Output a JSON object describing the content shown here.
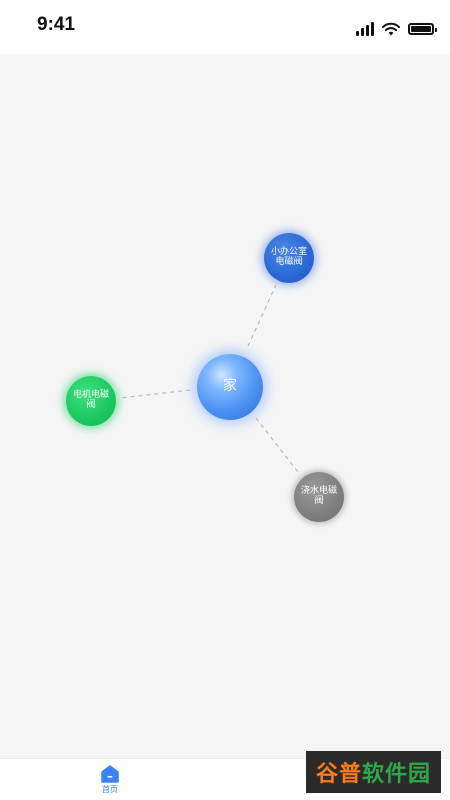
{
  "status_bar": {
    "time": "9:41",
    "icons": [
      "cellular-signal-icon",
      "wifi-icon",
      "battery-icon"
    ]
  },
  "graph": {
    "center": {
      "label": "家"
    },
    "nodes": [
      {
        "id": "office",
        "label": "小办公室电磁阀",
        "color": "#2b68d6"
      },
      {
        "id": "motor",
        "label": "电机电磁阀",
        "color": "#19c960"
      },
      {
        "id": "water",
        "label": "浇水电磁阀",
        "color": "#7e7e7e"
      }
    ],
    "link_color": "#b9b9b9"
  },
  "tab_bar": {
    "tabs": [
      {
        "label": "首页",
        "icon": "home-icon",
        "active": true,
        "color": "#3b82f6"
      },
      {
        "label": "",
        "icon": "tab-icon",
        "active": false,
        "color": "#b0b0b0"
      }
    ]
  },
  "watermark": {
    "part1": "谷普",
    "part2": "软件园"
  }
}
